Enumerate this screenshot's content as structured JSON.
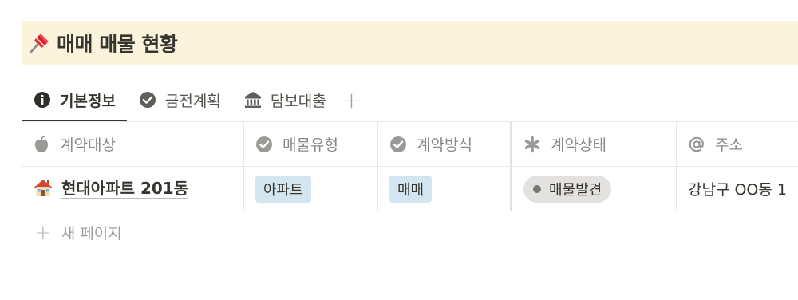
{
  "page": {
    "title": "매매 매물 현황",
    "title_icon": "pushpin-icon",
    "banner_color": "#fbf3db"
  },
  "tabs": [
    {
      "label": "기본정보",
      "icon": "info-icon",
      "active": true
    },
    {
      "label": "금전계획",
      "icon": "check-circle-icon",
      "active": false
    },
    {
      "label": "담보대출",
      "icon": "bank-icon",
      "active": false
    }
  ],
  "tab_add_label": "+",
  "table": {
    "columns": [
      {
        "label": "계약대상",
        "icon": "apple-icon"
      },
      {
        "label": "매물유형",
        "icon": "check-circle-icon"
      },
      {
        "label": "계약방식",
        "icon": "check-circle-icon"
      },
      {
        "label": "계약상태",
        "icon": "asterisk-icon"
      },
      {
        "label": "주소",
        "icon": "at-icon"
      }
    ],
    "rows": [
      {
        "name": "현대아파트 201동",
        "name_icon": "house-icon",
        "type": "아파트",
        "method": "매매",
        "status": "매물발견",
        "address": "강남구 OO동 1"
      }
    ],
    "new_page_label": "새 페이지",
    "tag_color": "#d3e5ef",
    "status_color": "#e3e2e0"
  }
}
